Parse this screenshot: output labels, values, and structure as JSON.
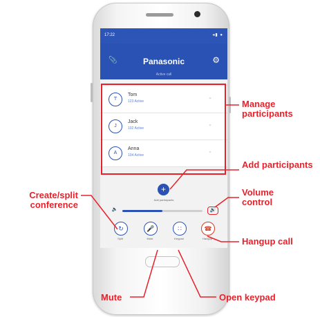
{
  "status": {
    "time": "17:22",
    "icons": "◂▮ ●"
  },
  "app": {
    "brand": "Panasonic",
    "subtitle": "Active call"
  },
  "participants": [
    {
      "initial": "T",
      "name": "Tom",
      "status": "123 Active"
    },
    {
      "initial": "J",
      "name": "Jack",
      "status": "102 Active"
    },
    {
      "initial": "A",
      "name": "Anna",
      "status": "104 Active"
    }
  ],
  "add": {
    "label": "Add participants"
  },
  "volume": {
    "level": 0.5
  },
  "controls": [
    {
      "icon": "split-icon",
      "label": "Split"
    },
    {
      "icon": "mute-icon",
      "label": "Mute"
    },
    {
      "icon": "keypad-icon",
      "label": "Keypad"
    },
    {
      "icon": "hangup-icon",
      "label": "Hangup"
    }
  ],
  "callouts": {
    "manage": "Manage participants",
    "add": "Add participants",
    "volume": "Volume control",
    "create": "Create/split conference",
    "hangup": "Hangup call",
    "mute": "Mute",
    "keypad": "Open keypad"
  },
  "colors": {
    "accent": "#2a52b5",
    "annotation": "#e8202a",
    "hangup": "#d33a24"
  }
}
